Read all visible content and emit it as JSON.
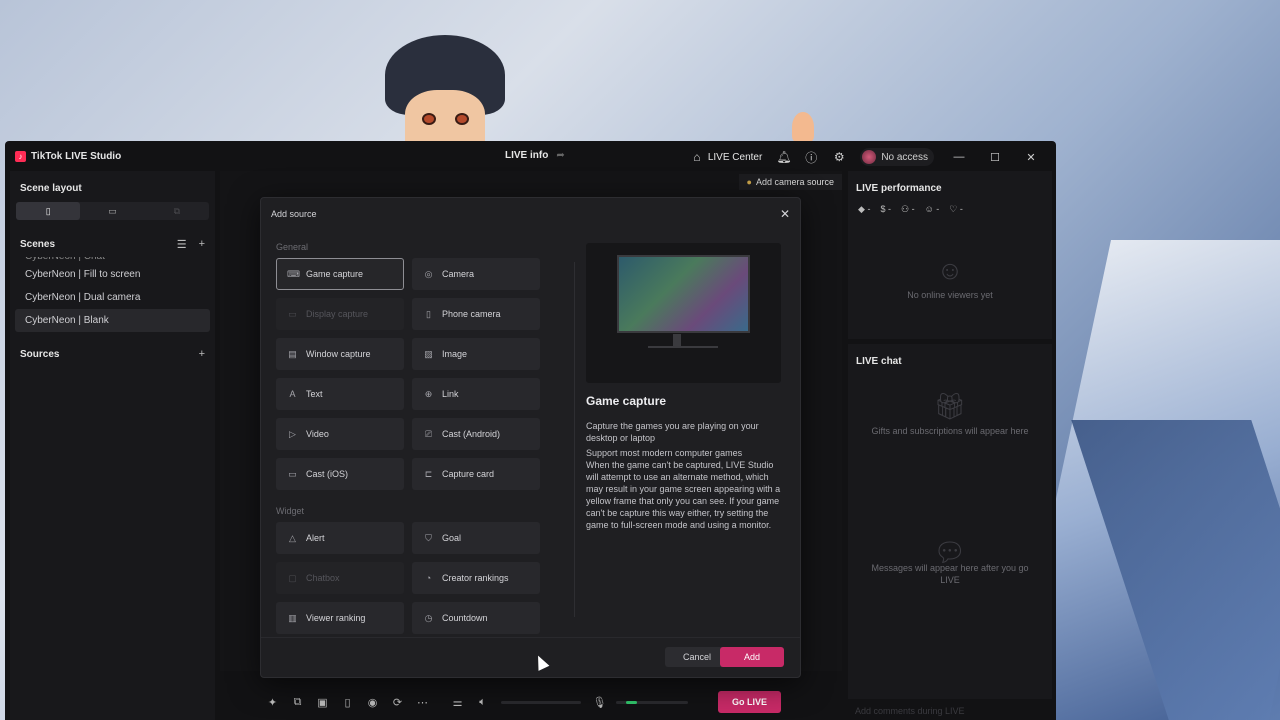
{
  "app": {
    "name": "TikTok LIVE Studio",
    "live_info": "LIVE info",
    "live_center": "LIVE Center",
    "access": "No access",
    "controls": {
      "minimize": "—",
      "maximize": "☐",
      "close": "✕"
    }
  },
  "left_panel": {
    "scene_layout": "Scene layout",
    "layout_tabs": [
      "portrait",
      "landscape",
      "dual"
    ],
    "scenes_title": "Scenes",
    "scenes": [
      "CyberNeon | Chat",
      "CyberNeon | Fill to screen",
      "CyberNeon | Dual camera",
      "CyberNeon | Blank"
    ],
    "sources_title": "Sources"
  },
  "canvas": {
    "add_camera_source": "Add camera source"
  },
  "modal": {
    "title": "Add source",
    "general_label": "General",
    "general_items": [
      {
        "label": "Game capture",
        "icon": "gamepad-icon",
        "state": "selected"
      },
      {
        "label": "Camera",
        "icon": "camera-icon",
        "state": "normal"
      },
      {
        "label": "Display capture",
        "icon": "monitor-icon",
        "state": "disabled"
      },
      {
        "label": "Phone camera",
        "icon": "phone-icon",
        "state": "normal"
      },
      {
        "label": "Window capture",
        "icon": "window-icon",
        "state": "normal"
      },
      {
        "label": "Image",
        "icon": "image-icon",
        "state": "normal"
      },
      {
        "label": "Text",
        "icon": "text-icon",
        "state": "normal"
      },
      {
        "label": "Link",
        "icon": "globe-icon",
        "state": "normal"
      },
      {
        "label": "Video",
        "icon": "play-icon",
        "state": "normal"
      },
      {
        "label": "Cast (Android)",
        "icon": "cast-icon",
        "state": "normal"
      },
      {
        "label": "Cast (iOS)",
        "icon": "cast-ios-icon",
        "state": "normal"
      },
      {
        "label": "Capture card",
        "icon": "capture-card-icon",
        "state": "normal"
      }
    ],
    "widget_label": "Widget",
    "widget_items": [
      {
        "label": "Alert",
        "icon": "bell-icon",
        "state": "normal"
      },
      {
        "label": "Goal",
        "icon": "goal-icon",
        "state": "normal"
      },
      {
        "label": "Chatbox",
        "icon": "chat-icon",
        "state": "disabled"
      },
      {
        "label": "Creator rankings",
        "icon": "ranking-icon",
        "state": "normal"
      },
      {
        "label": "Viewer ranking",
        "icon": "podium-icon",
        "state": "normal"
      },
      {
        "label": "Countdown",
        "icon": "timer-icon",
        "state": "normal"
      }
    ],
    "detail_title": "Game capture",
    "detail_paragraphs": [
      "Capture the games you are playing on your desktop or laptop",
      "Support most modern computer games",
      "When the game can't be captured, LIVE Studio will attempt to use an alternate method, which may result in your game screen appearing with a yellow frame that only you can see. If your game can't be capture this way either, try setting the game to full-screen mode and using a monitor."
    ],
    "cancel_label": "Cancel",
    "add_label": "Add"
  },
  "right_panel": {
    "performance_title": "LIVE performance",
    "stats": [
      "-",
      "-",
      "-",
      "-",
      "-"
    ],
    "no_viewers": "No online viewers yet",
    "chat_title": "LIVE chat",
    "gifts_empty": "Gifts and subscriptions will appear here",
    "messages_empty": "Messages will appear here after you go LIVE",
    "chat_placeholder": "Add comments during LIVE"
  },
  "bottom_bar": {
    "go_live": "Go LIVE",
    "mic_level": 0.15
  },
  "colors": {
    "accent": "#c82a67",
    "brand": "#fe2c55",
    "mic": "#31c46b"
  }
}
